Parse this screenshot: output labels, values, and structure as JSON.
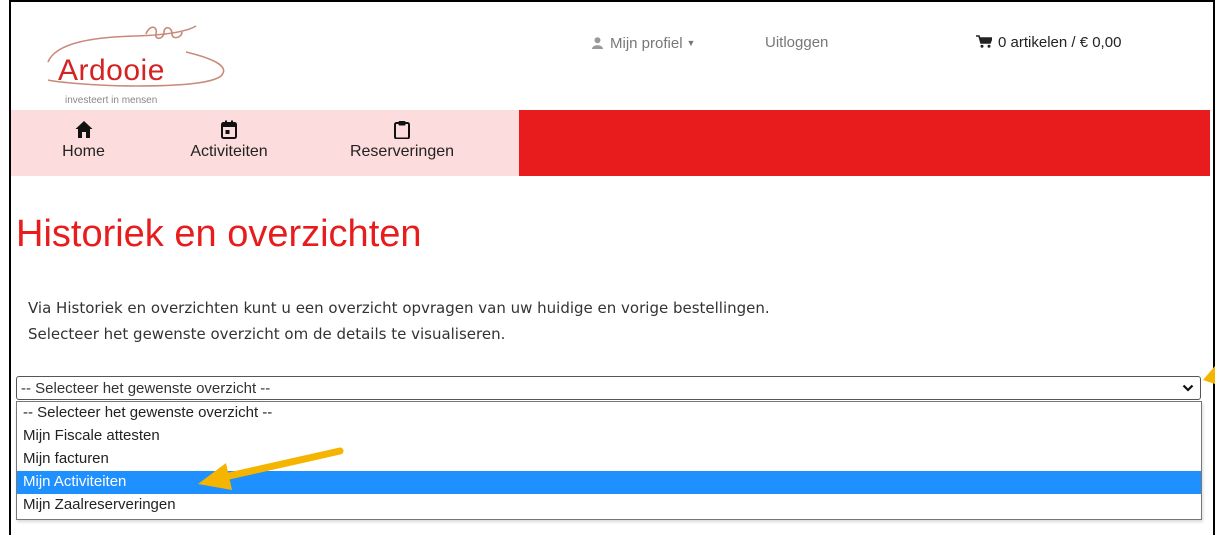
{
  "header": {
    "logo": {
      "word": "Ardooie",
      "tagline": "investeert in mensen"
    },
    "profile_label": "Mijn profiel",
    "logout_label": "Uitloggen",
    "cart_label": "0 artikelen / € 0,00"
  },
  "nav": {
    "tabs": [
      {
        "label": "Home",
        "icon": "home-icon"
      },
      {
        "label": "Activiteiten",
        "icon": "calendar-icon"
      },
      {
        "label": "Reserveringen",
        "icon": "clipboard-icon"
      }
    ]
  },
  "colors": {
    "accent": "#e81c1c",
    "nav_tab_bg": "#fcdcdc",
    "selected_option": "#1e90ff",
    "annotation_arrow": "#f5b400"
  },
  "main": {
    "title": "Historiek en overzichten",
    "intro_line1": "Via Historiek en overzichten kunt u een overzicht opvragen van uw huidige en vorige bestellingen.",
    "intro_line2": "Selecteer het gewenste overzicht om de details te visualiseren.",
    "select": {
      "value": "-- Selecteer het gewenste overzicht --",
      "options": [
        "-- Selecteer het gewenste overzicht --",
        "Mijn Fiscale attesten",
        "Mijn facturen",
        "Mijn Activiteiten",
        "Mijn Zaalreserveringen"
      ],
      "highlighted_option": "Mijn Activiteiten"
    }
  }
}
